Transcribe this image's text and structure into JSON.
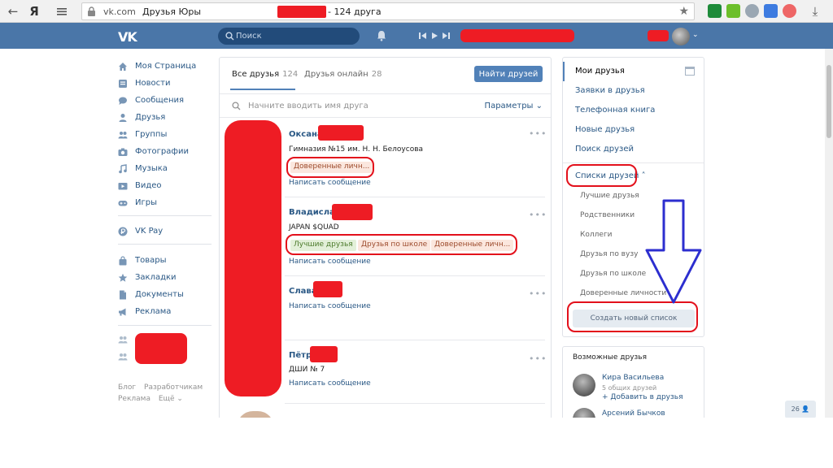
{
  "browser": {
    "back_icon": "←",
    "yandex_icon": "Я",
    "host": "vk.com",
    "title_prefix": "Друзья Юры",
    "title_suffix": "- 124 друга",
    "star_icon": "★",
    "download_icon": "⤓"
  },
  "header": {
    "logo": "VK",
    "search_placeholder": "Поиск"
  },
  "left_nav": {
    "items": [
      {
        "label": "Моя Страница",
        "icon": "home-icon"
      },
      {
        "label": "Новости",
        "icon": "news-icon"
      },
      {
        "label": "Сообщения",
        "icon": "messages-icon"
      },
      {
        "label": "Друзья",
        "icon": "friends-icon"
      },
      {
        "label": "Группы",
        "icon": "groups-icon"
      },
      {
        "label": "Фотографии",
        "icon": "camera-icon"
      },
      {
        "label": "Музыка",
        "icon": "music-icon"
      },
      {
        "label": "Видео",
        "icon": "video-icon"
      },
      {
        "label": "Игры",
        "icon": "games-icon"
      },
      {
        "label": "VK Pay",
        "icon": "vkpay-icon"
      },
      {
        "label": "Товары",
        "icon": "bag-icon"
      },
      {
        "label": "Закладки",
        "icon": "star-icon"
      },
      {
        "label": "Документы",
        "icon": "document-icon"
      },
      {
        "label": "Реклама",
        "icon": "megaphone-icon"
      }
    ],
    "footer": [
      "Блог",
      "Разработчикам",
      "Реклама",
      "Ещё ⌄"
    ]
  },
  "main": {
    "tabs": [
      {
        "label": "Все друзья",
        "count": "124"
      },
      {
        "label": "Друзья онлайн",
        "count": "28"
      }
    ],
    "find_button": "Найти друзей",
    "search_placeholder": "Начните вводить имя друга",
    "params_label": "Параметры ⌄",
    "friends": [
      {
        "name": "Оксана",
        "sub": "Гимназия №15 им. Н. Н. Белоусова",
        "tags": [
          "Доверенные личн..."
        ],
        "link": "Написать сообщение"
      },
      {
        "name": "Владислав",
        "sub": "JAPAN $QUAD",
        "tags": [
          "Лучшие друзья",
          "Друзья по школе",
          "Доверенные личн..."
        ],
        "link": "Написать сообщение"
      },
      {
        "name": "Слава",
        "sub": "",
        "tags": [],
        "link": "Написать сообщение"
      },
      {
        "name": "Пётр",
        "sub": "ДШИ № 7",
        "tags": [],
        "link": "Написать сообщение"
      }
    ],
    "more_icon": "•••"
  },
  "right": {
    "menu": [
      "Мои друзья",
      "Заявки в друзья",
      "Телефонная книга",
      "Новые друзья",
      "Поиск друзей"
    ],
    "lists_header": "Списки друзей ˄",
    "lists": [
      "Лучшие друзья",
      "Родственники",
      "Коллеги",
      "Друзья по вузу",
      "Друзья по школе",
      "Доверенные личности"
    ],
    "create_button": "Создать новый список",
    "possible_title": "Возможные друзья",
    "possible": [
      {
        "name": "Кира Васильева",
        "meta": "5 общих друзей",
        "add": "+ Добавить в друзья"
      },
      {
        "name": "Арсений Бычков"
      }
    ],
    "chat_badge": "26 👤"
  },
  "colors": {
    "header_blue": "#4a76a8",
    "link_blue": "#2a5885",
    "annotation_red": "#e3101b",
    "annotation_arrow": "#2c2ecf"
  }
}
